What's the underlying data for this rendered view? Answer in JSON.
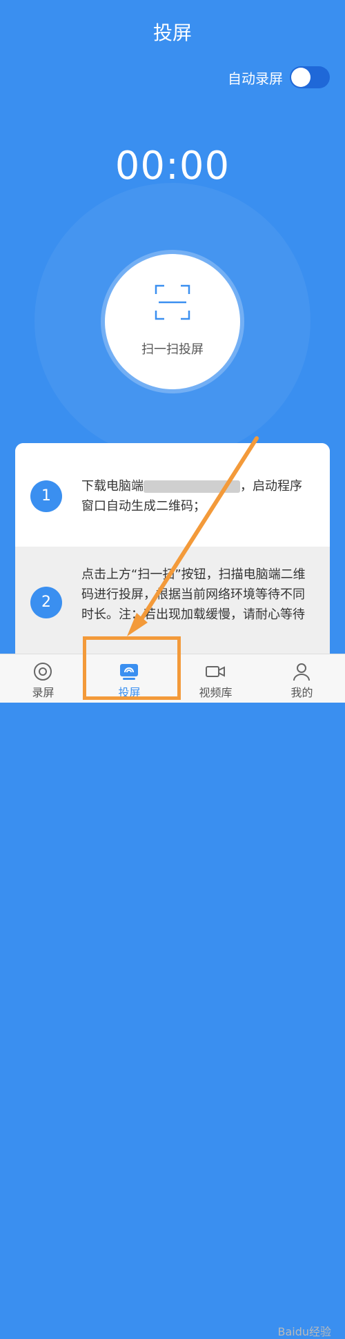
{
  "header": {
    "title": "投屏"
  },
  "auto_record": {
    "label": "自动录屏",
    "enabled": false
  },
  "timer": "00:00",
  "scan": {
    "label": "扫一扫投屏",
    "icon": "scan-frame-icon"
  },
  "steps": [
    {
      "number": "1",
      "text_before": "下载电脑端",
      "text_after": "，启动程序窗口自动生成二维码；"
    },
    {
      "number": "2",
      "text": "点击上方“扫一扫”按钮，扫描电脑端二维码进行投屏，根据当前网络环境等待不同时长。注：若出现加载缓慢，请耐心等待"
    }
  ],
  "nav": [
    {
      "label": "录屏",
      "icon": "record-disc-icon"
    },
    {
      "label": "投屏",
      "icon": "cast-screen-icon",
      "active": true
    },
    {
      "label": "视频库",
      "icon": "video-camera-icon"
    },
    {
      "label": "我的",
      "icon": "user-profile-icon"
    }
  ],
  "watermark": "Baidu经验",
  "colors": {
    "primary": "#3a8ff0",
    "annotation": "#f39a3a"
  }
}
